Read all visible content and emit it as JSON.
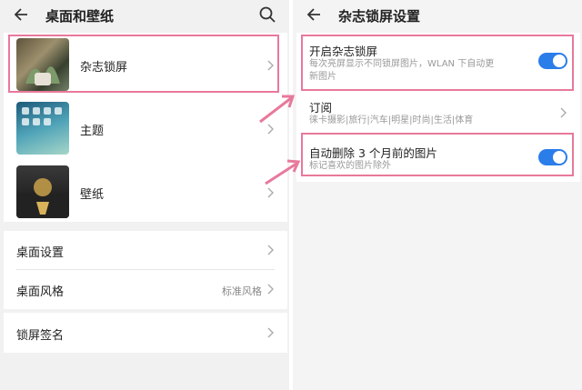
{
  "left": {
    "title": "桌面和壁纸",
    "items": [
      {
        "label": "杂志锁屏"
      },
      {
        "label": "主题"
      },
      {
        "label": "壁纸"
      }
    ],
    "settings": [
      {
        "label": "桌面设置",
        "value": ""
      },
      {
        "label": "桌面风格",
        "value": "标准风格"
      },
      {
        "label": "锁屏签名",
        "value": ""
      }
    ]
  },
  "right": {
    "title": "杂志锁屏设置",
    "items": [
      {
        "title": "开启杂志锁屏",
        "subtitle_line1": "每次亮屏显示不同锁屏图片，WLAN 下自动更",
        "subtitle_line2": "新图片",
        "toggle": "on"
      },
      {
        "title": "订阅",
        "subtitle_line1": "徕卡摄影|旅行|汽车|明星|时尚|生活|体育"
      },
      {
        "title": "自动删除 3 个月前的图片",
        "subtitle_line1": "标记喜欢的图片除外",
        "toggle": "on"
      }
    ]
  },
  "colors": {
    "accent": "#2b7de9",
    "highlight": "#e8799b"
  },
  "icons": [
    "back-arrow-icon",
    "search-icon",
    "chevron-right-icon",
    "pink-pointer-arrow-icon"
  ]
}
